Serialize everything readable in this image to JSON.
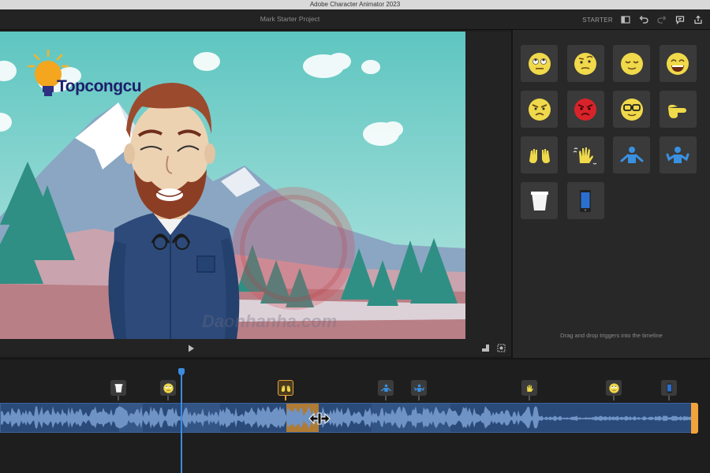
{
  "window": {
    "title": "Adobe Character Animator 2023"
  },
  "toolbar": {
    "project_name": "Mark Starter Project",
    "mode_label": "STARTER",
    "icons": [
      "layout-icon",
      "undo-icon",
      "redo-icon",
      "comment-icon",
      "share-icon"
    ]
  },
  "overlay": {
    "logo_text": "Topcongcu",
    "watermark_text": "Daonhanha.com"
  },
  "viewer": {
    "controls": [
      "play-icon",
      "fit-view-icon",
      "camera-icon"
    ]
  },
  "triggers_panel": {
    "hint": "Drag and drop triggers into the timeline",
    "items": [
      {
        "name": "eye-roll-trigger",
        "icon": "eye-roll-emoji-icon"
      },
      {
        "name": "suspicious-trigger",
        "icon": "raised-eyebrow-emoji-icon"
      },
      {
        "name": "relieved-trigger",
        "icon": "relieved-emoji-icon"
      },
      {
        "name": "grin-trigger",
        "icon": "grinning-emoji-icon"
      },
      {
        "name": "angry-trigger",
        "icon": "angry-emoji-icon"
      },
      {
        "name": "furious-trigger",
        "icon": "red-angry-emoji-icon"
      },
      {
        "name": "nerd-trigger",
        "icon": "glasses-emoji-icon"
      },
      {
        "name": "point-trigger",
        "icon": "pointing-hand-icon"
      },
      {
        "name": "jazz-hands-trigger",
        "icon": "jazz-hands-icon"
      },
      {
        "name": "wave-trigger",
        "icon": "waving-hand-icon"
      },
      {
        "name": "shrug-arms-out-trigger",
        "icon": "person-arms-out-icon"
      },
      {
        "name": "shrug-trigger",
        "icon": "person-shrug-icon"
      },
      {
        "name": "cup-trigger",
        "icon": "paper-cup-icon"
      },
      {
        "name": "phone-trigger",
        "icon": "smartphone-icon"
      }
    ]
  },
  "timeline": {
    "playhead_time_fraction": 0.256,
    "markers": [
      {
        "icon": "paper-cup-icon",
        "selected": false
      },
      {
        "icon": "eye-roll-emoji-icon",
        "selected": false
      },
      {
        "icon": "jazz-hands-icon",
        "selected": true
      },
      {
        "icon": "person-arms-out-icon",
        "selected": false
      },
      {
        "icon": "person-shrug-icon",
        "selected": false
      },
      {
        "icon": "waving-hand-icon",
        "selected": false
      },
      {
        "icon": "eye-roll-emoji-icon",
        "selected": false
      },
      {
        "icon": "smartphone-icon",
        "selected": false
      }
    ],
    "colors": {
      "track": "#2a4a79",
      "highlight": "#f2a33a",
      "playhead": "#3d8be0"
    }
  }
}
